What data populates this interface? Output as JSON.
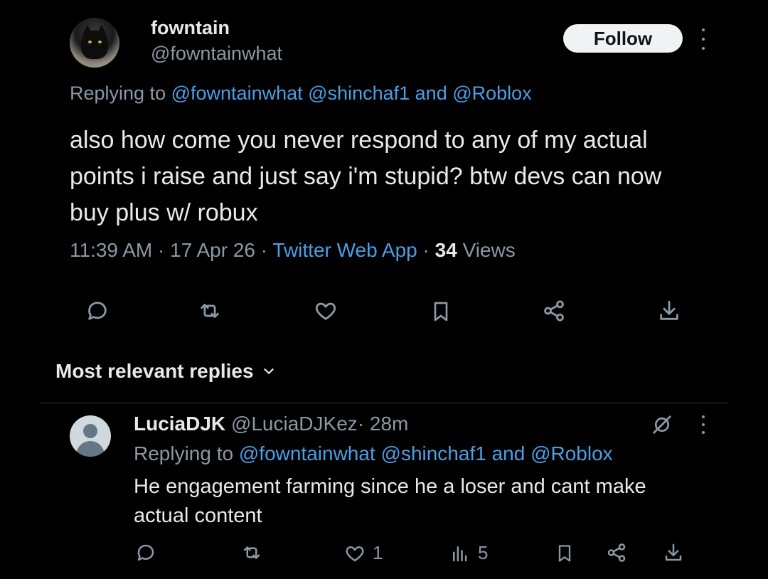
{
  "tweet": {
    "display_name": "fowntain",
    "handle": "@fowntainwhat",
    "follow_label": "Follow",
    "replying_prefix": "Replying to",
    "replying_mention1": "@fowntainwhat",
    "replying_mention2": "@shinchaf1",
    "replying_and": "and",
    "replying_mention3": "@Roblox",
    "text": "also how come you never respond to any of my actual points i raise and just say i'm stupid? btw devs can now buy plus w/ robux",
    "time": "11:39 AM",
    "date": "17 Apr 26",
    "source": "Twitter Web App",
    "views_count": "34",
    "views_label": "Views",
    "separator": "·"
  },
  "replies_section": {
    "title": "Most relevant replies"
  },
  "reply": {
    "display_name": "LuciaDJK",
    "handle": "@LuciaDJKez",
    "separator": "·",
    "time_ago": "28m",
    "replying_prefix": "Replying to",
    "replying_mention1": "@fowntainwhat",
    "replying_mention2": "@shinchaf1",
    "replying_and": "and",
    "replying_mention3": "@Roblox",
    "text": "He engagement farming since he a loser and cant make actual content",
    "like_count": "1",
    "views_count": "5"
  },
  "icons": {
    "reply": "reply-icon",
    "retweet": "retweet-icon",
    "like": "heart-icon",
    "bookmark": "bookmark-icon",
    "share": "share-icon",
    "download": "download-icon",
    "views": "views-icon",
    "grok": "grok-icon",
    "more": "more-icon",
    "chevron": "chevron-down-icon"
  },
  "colors": {
    "background": "#000000",
    "text_primary": "#e7e9ea",
    "text_secondary": "#8b98a5",
    "link": "#4a9fe6",
    "follow_bg": "#eff3f4"
  }
}
